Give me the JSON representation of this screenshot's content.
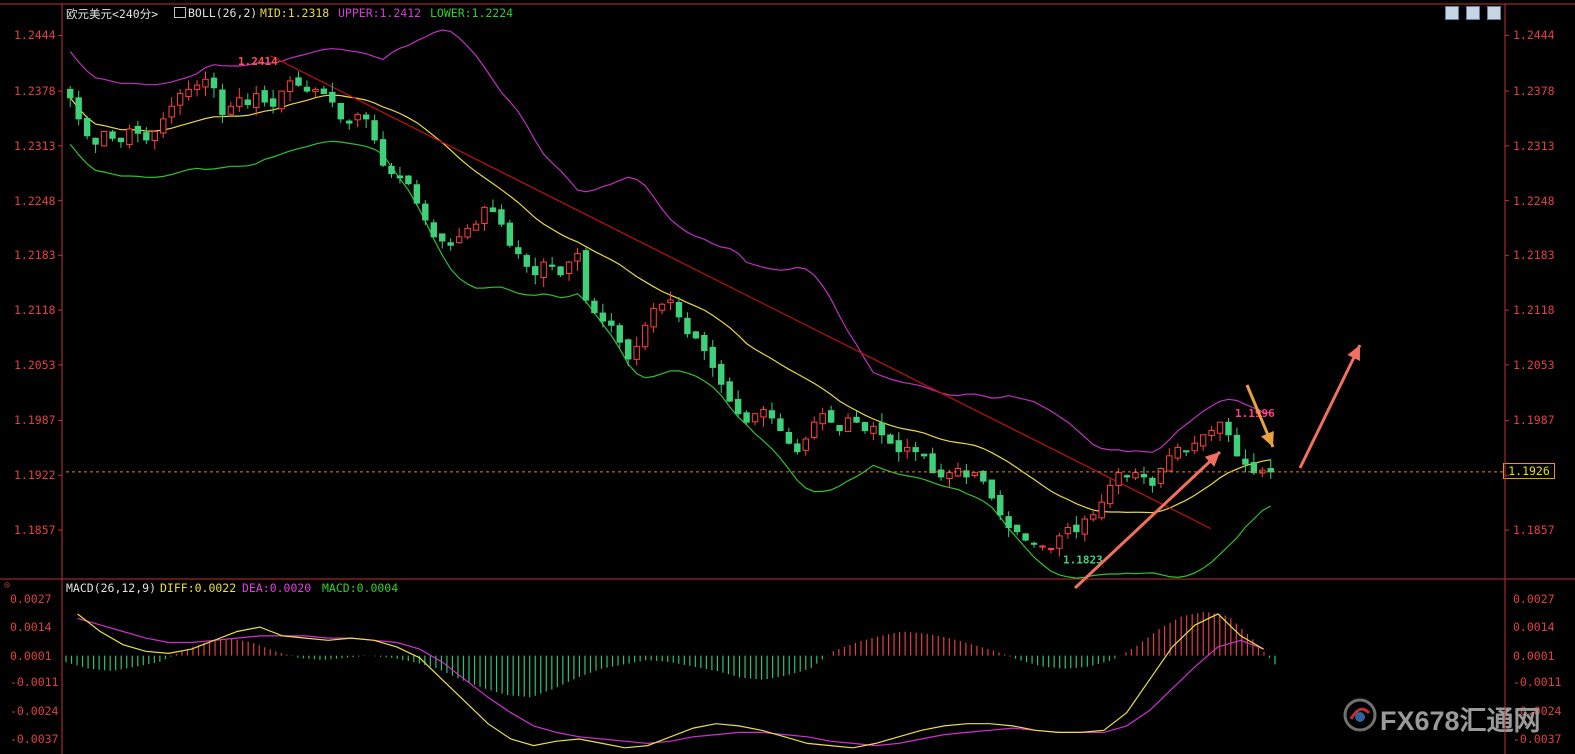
{
  "header": {
    "symbol": "欧元美元",
    "period": "<240分>",
    "boll_label": "BOLL(26,2)",
    "mid": "MID:1.2318",
    "upper": "UPPER:1.2412",
    "lower": "LOWER:1.2224"
  },
  "macd_header": {
    "label": "MACD(26,12,9)",
    "diff": "DIFF:0.0022",
    "dea": "DEA:0.0020",
    "macd": "MACD:0.0004"
  },
  "price_axis": [
    "1.2444",
    "1.2378",
    "1.2313",
    "1.2248",
    "1.2183",
    "1.2118",
    "1.2053",
    "1.1987",
    "1.1922",
    "1.1857"
  ],
  "macd_axis": [
    "0.0027",
    "0.0014",
    "0.0001",
    "-0.0011",
    "-0.0024",
    "-0.0037"
  ],
  "current_price": "1.1926",
  "annotations": {
    "high": "1.2414",
    "low": "1.1823",
    "recent_high": "1.1996"
  },
  "logo": {
    "text": "FX678汇通网"
  },
  "colors": {
    "up": "#ff4040",
    "down": "#3fd07a",
    "mid": "#e8d840",
    "upper": "#c030c0",
    "lower": "#30c030",
    "trend": "#c01010",
    "arrow": "#f07060",
    "arrow2": "#e8a040"
  },
  "chart_data": [
    {
      "type": "candlestick",
      "title": "欧元美元 240分",
      "ylim": [
        1.18,
        1.246
      ],
      "indicator": "BOLL(26,2)",
      "values": {
        "mid": 1.2318,
        "upper": 1.2412,
        "lower": 1.2224
      },
      "high": 1.2414,
      "low": 1.1823,
      "recent_high": 1.1996,
      "last": 1.1926,
      "trend": "downtrend from ~1.2414 to ~1.1823, then rebound to ~1.1996",
      "close_series": [
        1.237,
        1.2345,
        1.2325,
        1.2315,
        1.233,
        1.2322,
        1.2318,
        1.2333,
        1.2328,
        1.232,
        1.233,
        1.2345,
        1.236,
        1.2375,
        1.238,
        1.2385,
        1.2392,
        1.2382,
        1.235,
        1.236,
        1.237,
        1.2362,
        1.2375,
        1.2365,
        1.236,
        1.2378,
        1.239,
        1.2385,
        1.2378,
        1.238,
        1.2375,
        1.2365,
        1.2345,
        1.234,
        1.235,
        1.2345,
        1.232,
        1.229,
        1.228,
        1.2275,
        1.2268,
        1.2245,
        1.2225,
        1.2205,
        1.22,
        1.2195,
        1.2205,
        1.2215,
        1.222,
        1.224,
        1.2235,
        1.222,
        1.2195,
        1.2185,
        1.217,
        1.216,
        1.2175,
        1.217,
        1.216,
        1.2175,
        1.2185,
        1.213,
        1.2115,
        1.2105,
        1.21,
        1.208,
        1.206,
        1.2075,
        1.21,
        1.212,
        1.2125,
        1.213,
        1.211,
        1.209,
        1.2085,
        1.207,
        1.205,
        1.203,
        1.201,
        1.1995,
        1.1985,
        1.1995,
        1.2,
        1.199,
        1.1975,
        1.196,
        1.195,
        1.1965,
        1.1985,
        1.1995,
        1.1985,
        1.1975,
        1.199,
        1.1985,
        1.1975,
        1.198,
        1.197,
        1.196,
        1.195,
        1.1955,
        1.195,
        1.1945,
        1.1925,
        1.192,
        1.1925,
        1.193,
        1.192,
        1.1925,
        1.1915,
        1.1895,
        1.1875,
        1.186,
        1.1855,
        1.1845,
        1.184,
        1.1838,
        1.1835,
        1.185,
        1.186,
        1.1855,
        1.187,
        1.1875,
        1.189,
        1.191,
        1.1925,
        1.192,
        1.1925,
        1.192,
        1.191,
        1.193,
        1.1945,
        1.1955,
        1.195,
        1.196,
        1.197,
        1.1975,
        1.1985,
        1.197,
        1.1945,
        1.1935,
        1.1925,
        1.1928,
        1.1926
      ]
    },
    {
      "type": "line",
      "title": "MACD(26,12,9)",
      "ylim": [
        -0.0042,
        0.003
      ],
      "values": {
        "diff": 0.0022,
        "dea": 0.002,
        "macd": 0.0004
      },
      "diff_series": [
        0.002,
        0.0012,
        0.0006,
        0.0003,
        0.0002,
        0.0004,
        0.0008,
        0.0012,
        0.0014,
        0.001,
        0.0009,
        0.0008,
        0.0009,
        0.0008,
        0.0005,
        0.0,
        -0.001,
        -0.002,
        -0.003,
        -0.0037,
        -0.004,
        -0.0038,
        -0.0037,
        -0.0039,
        -0.0041,
        -0.004,
        -0.0036,
        -0.0032,
        -0.003,
        -0.0031,
        -0.0033,
        -0.0036,
        -0.0039,
        -0.004,
        -0.0041,
        -0.0039,
        -0.0036,
        -0.0033,
        -0.0031,
        -0.003,
        -0.003,
        -0.0031,
        -0.0033,
        -0.0034,
        -0.0034,
        -0.0033,
        -0.0025,
        -0.001,
        0.0005,
        0.0015,
        0.002,
        0.001,
        0.0004
      ],
      "dea_series": [
        0.0018,
        0.0015,
        0.0012,
        0.0009,
        0.0007,
        0.0007,
        0.0008,
        0.0009,
        0.001,
        0.001,
        0.001,
        0.0009,
        0.0009,
        0.0008,
        0.0007,
        0.0004,
        -0.0002,
        -0.001,
        -0.0018,
        -0.0025,
        -0.0031,
        -0.0034,
        -0.0036,
        -0.0037,
        -0.0038,
        -0.0039,
        -0.0038,
        -0.0036,
        -0.0035,
        -0.0034,
        -0.0034,
        -0.0035,
        -0.0036,
        -0.0038,
        -0.0039,
        -0.004,
        -0.0039,
        -0.0037,
        -0.0035,
        -0.0034,
        -0.0033,
        -0.0032,
        -0.0033,
        -0.0034,
        -0.0034,
        -0.0034,
        -0.0031,
        -0.0024,
        -0.0014,
        -0.0004,
        0.0005,
        0.0008,
        0.0004
      ],
      "hist_series": [
        -0.0003,
        -0.0006,
        -0.0007,
        -0.0005,
        -0.0003,
        0.0002,
        0.0006,
        0.0008,
        0.0006,
        0.0002,
        -0.0001,
        -0.0002,
        -0.0001,
        0.0,
        -0.0001,
        -0.0003,
        -0.0006,
        -0.0011,
        -0.0015,
        -0.0018,
        -0.0019,
        -0.0015,
        -0.001,
        -0.0006,
        -0.0004,
        -0.0002,
        -0.0003,
        -0.0005,
        -0.0007,
        -0.001,
        -0.0011,
        -0.0009,
        -0.0006,
        0.0002,
        0.0006,
        0.0009,
        0.0011,
        0.001,
        0.0008,
        0.0005,
        0.0002,
        -0.0002,
        -0.0005,
        -0.0006,
        -0.0005,
        -0.0002,
        0.0004,
        0.0012,
        0.0018,
        0.002,
        0.0018,
        0.0008,
        -0.0004
      ]
    }
  ]
}
